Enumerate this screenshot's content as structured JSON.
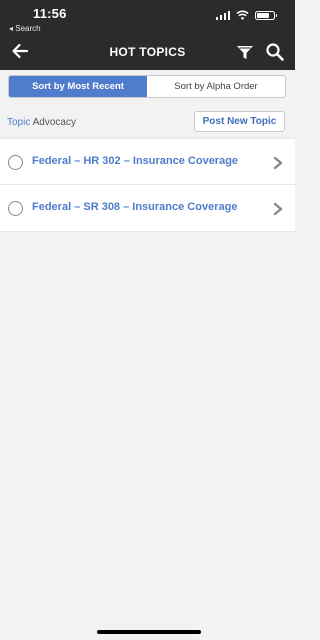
{
  "status": {
    "time": "11:56",
    "back_app": "◂ Search"
  },
  "nav": {
    "title": "HOT TOPICS"
  },
  "sort": {
    "options": [
      "Sort by Most Recent",
      "Sort by Alpha Order"
    ],
    "selected": "Sort by Most Recent"
  },
  "topic": {
    "key": "Topic",
    "value": "Advocacy",
    "post_button": "Post New Topic"
  },
  "topics": [
    {
      "title": "Federal – HR 302 – Insurance Coverage"
    },
    {
      "title": "Federal – SR 308 – Insurance Coverage"
    }
  ],
  "colors": {
    "accent": "#4f7ccc",
    "header": "#2b2b2b",
    "background": "#f2f2f2"
  },
  "icons": {
    "back": "arrow-left-icon",
    "filter": "filter-icon",
    "search": "search-icon",
    "row_chevron": "chevron-right-icon"
  }
}
